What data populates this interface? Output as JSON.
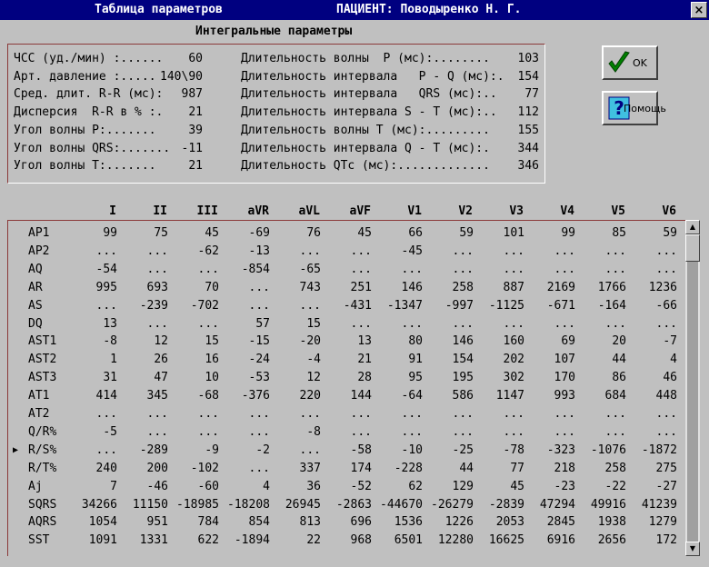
{
  "window": {
    "title": "Таблица параметров",
    "patient": "ПАЦИЕНТ: Поводыренко Н. Г.",
    "close_label": "×"
  },
  "integral": {
    "title": "Интегральные параметры",
    "left": [
      {
        "label": "ЧСС (уд./мин) :......",
        "value": "60"
      },
      {
        "label": "Арт. давление :.....",
        "value": "140\\90"
      },
      {
        "label": "Сред. длит. R-R (мс):",
        "value": "987"
      },
      {
        "label": "Дисперсия  R-R в % :.",
        "value": "21"
      },
      {
        "label": "Угол волны P:.......",
        "value": "39"
      },
      {
        "label": "Угол волны QRS:.......",
        "value": "-11"
      },
      {
        "label": "Угол волны T:.......",
        "value": "21"
      }
    ],
    "right": [
      {
        "label": "Длительность волны  P (мс):........",
        "value": "103"
      },
      {
        "label": "Длительность интервала   P - Q (мс):.",
        "value": "154"
      },
      {
        "label": "Длительность интервала   QRS (мс):..",
        "value": "77"
      },
      {
        "label": "Длительность интервала S - T (мс):..",
        "value": "112"
      },
      {
        "label": "Длительность волны T (мс):.........",
        "value": "155"
      },
      {
        "label": "Длительность интервала Q - T (мс):.",
        "value": "344"
      },
      {
        "label": "Длительность QTc (мс):.............",
        "value": "346"
      }
    ]
  },
  "buttons": {
    "ok": "OK",
    "help": "Помощь",
    "ok_icon": "checkmark-icon",
    "help_icon": "question-icon"
  },
  "table": {
    "columns": [
      "I",
      "II",
      "III",
      "aVR",
      "aVL",
      "aVF",
      "V1",
      "V2",
      "V3",
      "V4",
      "V5",
      "V6"
    ],
    "selected_row": "R/S%",
    "rows": [
      {
        "label": "AP1",
        "values": [
          "99",
          "75",
          "45",
          "-69",
          "76",
          "45",
          "66",
          "59",
          "101",
          "99",
          "85",
          "59"
        ]
      },
      {
        "label": "AP2",
        "values": [
          "...",
          "...",
          "-62",
          "-13",
          "...",
          "...",
          "-45",
          "...",
          "...",
          "...",
          "...",
          "..."
        ]
      },
      {
        "label": "AQ",
        "values": [
          "-54",
          "...",
          "...",
          "-854",
          "-65",
          "...",
          "...",
          "...",
          "...",
          "...",
          "...",
          "..."
        ]
      },
      {
        "label": "AR",
        "values": [
          "995",
          "693",
          "70",
          "...",
          "743",
          "251",
          "146",
          "258",
          "887",
          "2169",
          "1766",
          "1236"
        ]
      },
      {
        "label": "AS",
        "values": [
          "...",
          "-239",
          "-702",
          "...",
          "...",
          "-431",
          "-1347",
          "-997",
          "-1125",
          "-671",
          "-164",
          "-66"
        ]
      },
      {
        "label": "DQ",
        "values": [
          "13",
          "...",
          "...",
          "57",
          "15",
          "...",
          "...",
          "...",
          "...",
          "...",
          "...",
          "..."
        ]
      },
      {
        "label": "AST1",
        "values": [
          "-8",
          "12",
          "15",
          "-15",
          "-20",
          "13",
          "80",
          "146",
          "160",
          "69",
          "20",
          "-7"
        ]
      },
      {
        "label": "AST2",
        "values": [
          "1",
          "26",
          "16",
          "-24",
          "-4",
          "21",
          "91",
          "154",
          "202",
          "107",
          "44",
          "4"
        ]
      },
      {
        "label": "AST3",
        "values": [
          "31",
          "47",
          "10",
          "-53",
          "12",
          "28",
          "95",
          "195",
          "302",
          "170",
          "86",
          "46"
        ]
      },
      {
        "label": "AT1",
        "values": [
          "414",
          "345",
          "-68",
          "-376",
          "220",
          "144",
          "-64",
          "586",
          "1147",
          "993",
          "684",
          "448"
        ]
      },
      {
        "label": "AT2",
        "values": [
          "...",
          "...",
          "...",
          "...",
          "...",
          "...",
          "...",
          "...",
          "...",
          "...",
          "...",
          "..."
        ]
      },
      {
        "label": "Q/R%",
        "values": [
          "-5",
          "...",
          "...",
          "...",
          "-8",
          "...",
          "...",
          "...",
          "...",
          "...",
          "...",
          "..."
        ]
      },
      {
        "label": "R/S%",
        "values": [
          "...",
          "-289",
          "-9",
          "-2",
          "...",
          "-58",
          "-10",
          "-25",
          "-78",
          "-323",
          "-1076",
          "-1872"
        ]
      },
      {
        "label": "R/T%",
        "values": [
          "240",
          "200",
          "-102",
          "...",
          "337",
          "174",
          "-228",
          "44",
          "77",
          "218",
          "258",
          "275"
        ]
      },
      {
        "label": "Aj",
        "values": [
          "7",
          "-46",
          "-60",
          "4",
          "36",
          "-52",
          "62",
          "129",
          "45",
          "-23",
          "-22",
          "-27"
        ]
      },
      {
        "label": "SQRS",
        "values": [
          "34266",
          "11150",
          "-18985",
          "-18208",
          "26945",
          "-2863",
          "-44670",
          "-26279",
          "-2839",
          "47294",
          "49916",
          "41239"
        ]
      },
      {
        "label": "AQRS",
        "values": [
          "1054",
          "951",
          "784",
          "854",
          "813",
          "696",
          "1536",
          "1226",
          "2053",
          "2845",
          "1938",
          "1279"
        ]
      },
      {
        "label": "SST",
        "values": [
          "1091",
          "1331",
          "622",
          "-1894",
          "22",
          "968",
          "6501",
          "12280",
          "16625",
          "6916",
          "2656",
          "172"
        ]
      }
    ]
  }
}
